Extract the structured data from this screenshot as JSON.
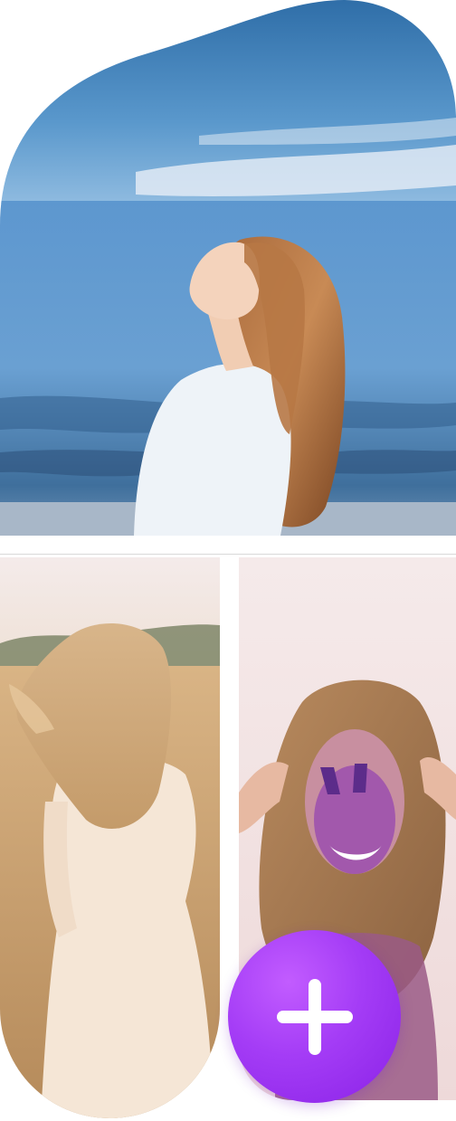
{
  "gallery": {
    "photos": [
      {
        "subject": "woman-by-sea"
      },
      {
        "subject": "woman-in-wheat-field"
      },
      {
        "subject": "woman-with-purple-paint"
      }
    ],
    "add_button": {
      "icon": "plus-icon"
    }
  },
  "colors": {
    "accent": "#a43cf6",
    "sky": "#4a8dc6",
    "sea": "#5b93c9",
    "field": "#c9a777",
    "paint": "#7b2fc0"
  }
}
